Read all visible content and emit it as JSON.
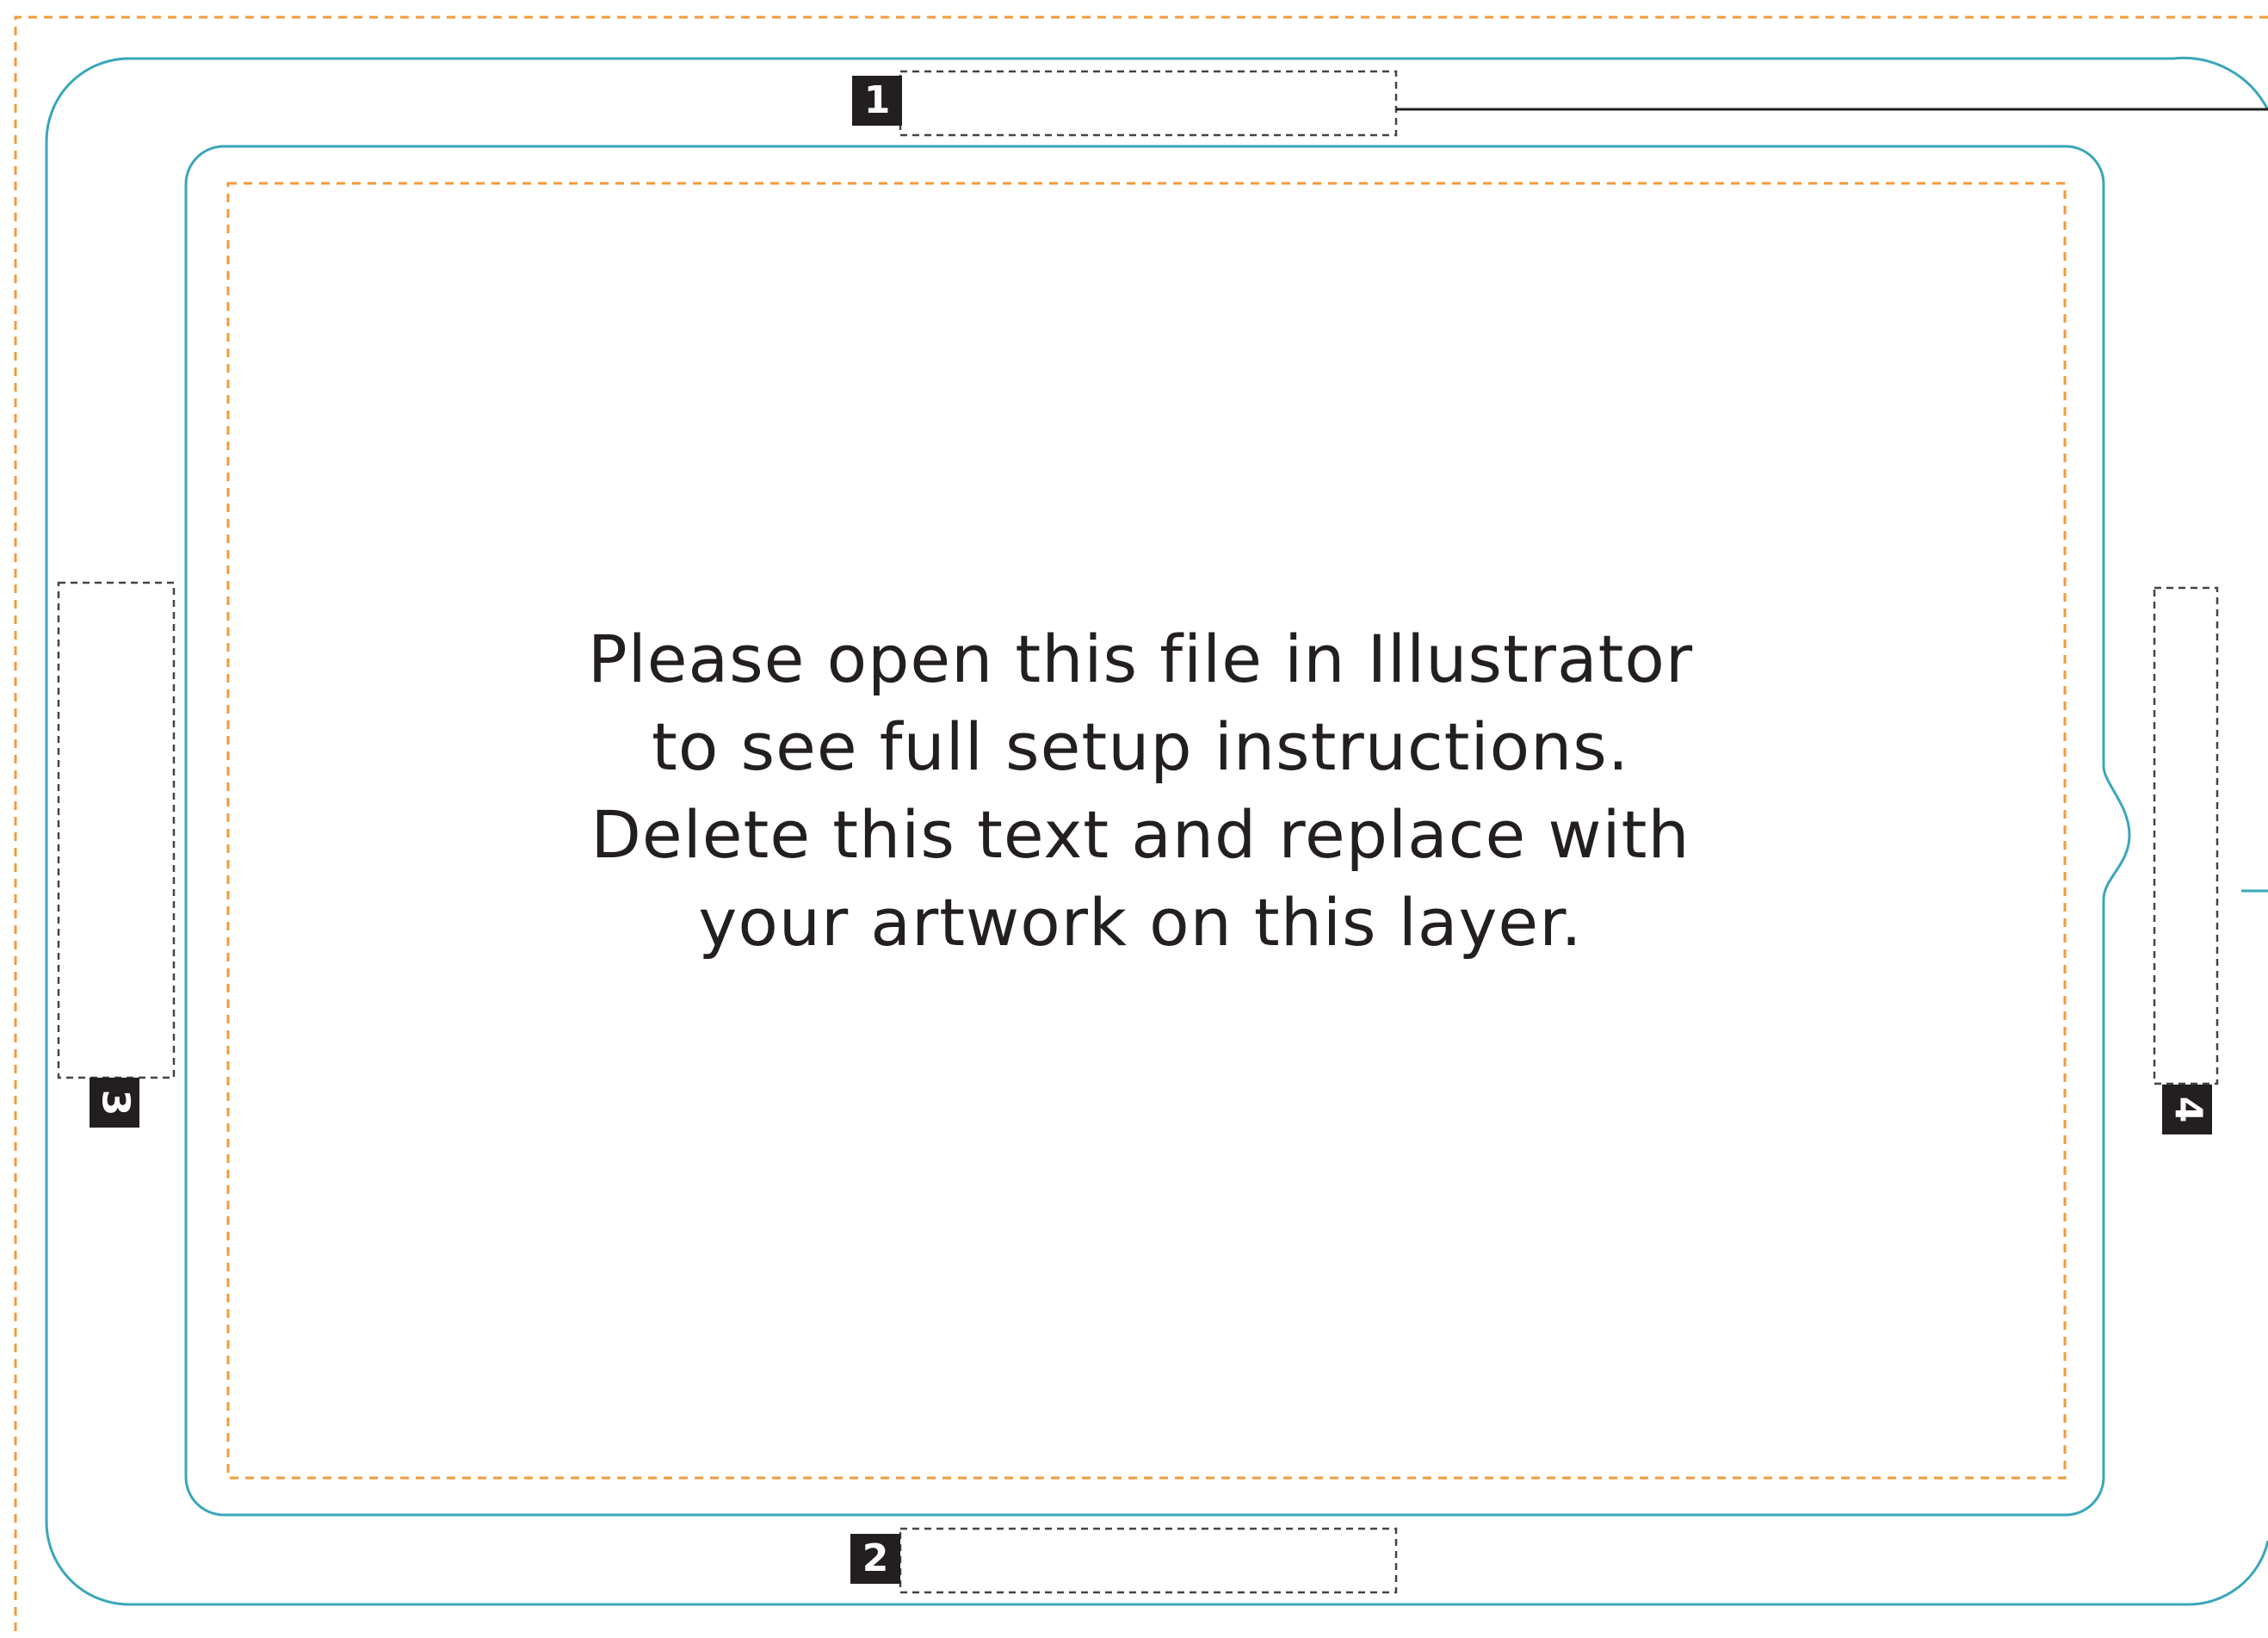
{
  "instructions": {
    "line1": "Please open this file in Illustrator",
    "line2": "to see full setup instructions.",
    "line3": "Delete this text and replace with",
    "line4": "your artwork on this layer."
  },
  "markers": {
    "m1": "1",
    "m2": "2",
    "m3": "3",
    "m4": "4"
  },
  "colors": {
    "bleed_guide": "#f39a3b",
    "cut_line": "#3aa6b9",
    "text": "#231f20",
    "placeholder_border": "#444444"
  }
}
